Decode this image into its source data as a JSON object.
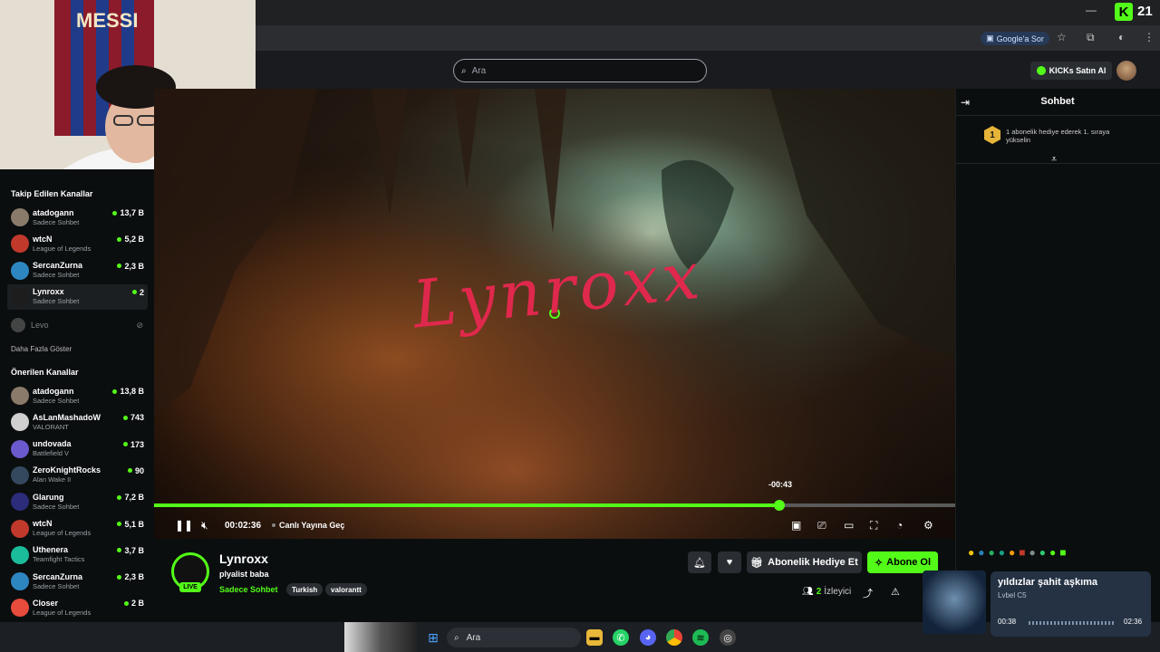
{
  "browser": {
    "google_ask_label": "Google'a Sor",
    "kick_badge_number": "21"
  },
  "site": {
    "search_placeholder": "Ara",
    "buy_kicks_label": "KICKs Satın Al"
  },
  "webcam": {
    "shirt_text": "MESSI"
  },
  "sidebar": {
    "followed_heading": "Takip Edilen Kanallar",
    "followed": [
      {
        "name": "atadogann",
        "category": "Sadece Sohbet",
        "viewers": "13,7 B",
        "color": "#8a7a6a"
      },
      {
        "name": "wtcN",
        "category": "League of Legends",
        "viewers": "5,2 B",
        "color": "#c0392b"
      },
      {
        "name": "SercanZurna",
        "category": "Sadece Sohbet",
        "viewers": "2,3 B",
        "color": "#2e86c1"
      },
      {
        "name": "Lynroxx",
        "category": "Sadece Sohbet",
        "viewers": "2",
        "color": "#1d1d1d"
      }
    ],
    "offline_channel": "Levo",
    "show_more_label": "Daha Fazla Göster",
    "recommended_heading": "Önerilen Kanallar",
    "recommended": [
      {
        "name": "atadogann",
        "category": "Sadece Sohbet",
        "viewers": "13,8 B",
        "color": "#8a7a6a"
      },
      {
        "name": "AsLanMashadoW",
        "category": "VALORANT",
        "viewers": "743",
        "color": "#d0d0d0"
      },
      {
        "name": "undovada",
        "category": "Battlefield V",
        "viewers": "173",
        "color": "#6a5acd"
      },
      {
        "name": "ZeroKnightRocks",
        "category": "Alan Wake II",
        "viewers": "90",
        "color": "#34495e"
      },
      {
        "name": "Glarung",
        "category": "Sadece Sohbet",
        "viewers": "7,2 B",
        "color": "#2c2c7a"
      },
      {
        "name": "wtcN",
        "category": "League of Legends",
        "viewers": "5,1 B",
        "color": "#c0392b"
      },
      {
        "name": "Uthenera",
        "category": "Teamfight Tactics",
        "viewers": "3,7 B",
        "color": "#1abc9c"
      },
      {
        "name": "SercanZurna",
        "category": "Sadece Sohbet",
        "viewers": "2,3 B",
        "color": "#2e86c1"
      },
      {
        "name": "Closer",
        "category": "League of Legends",
        "viewers": "2 B",
        "color": "#e74c3c"
      }
    ]
  },
  "player": {
    "overlay_text": "Lynroxx",
    "hover_time": "-00:43",
    "current_time": "00:02:36",
    "go_live_label": "Canlı Yayına Geç",
    "progress_fraction": 0.78
  },
  "stream": {
    "streamer_name": "Lynroxx",
    "title": "plyalist baba",
    "category": "Sadece Sohbet",
    "tags": [
      "Turkish",
      "valorantt"
    ],
    "live_badge": "LIVE",
    "viewer_count": "2",
    "viewer_label": "İzleyici",
    "gift_sub_label": "Abonelik Hediye Et",
    "subscribe_label": "Abone Ol"
  },
  "chat": {
    "title": "Sohbet",
    "gift_rank_number": "1",
    "gift_rank_text": "1 abonelik hediye ederek 1. sıraya yükselin"
  },
  "taskbar": {
    "search_placeholder": "Ara"
  },
  "media_popup": {
    "song_title": "yıldızlar şahit aşkıma",
    "artist": "Lvbel C5",
    "elapsed": "00:38",
    "duration": "02:36"
  }
}
